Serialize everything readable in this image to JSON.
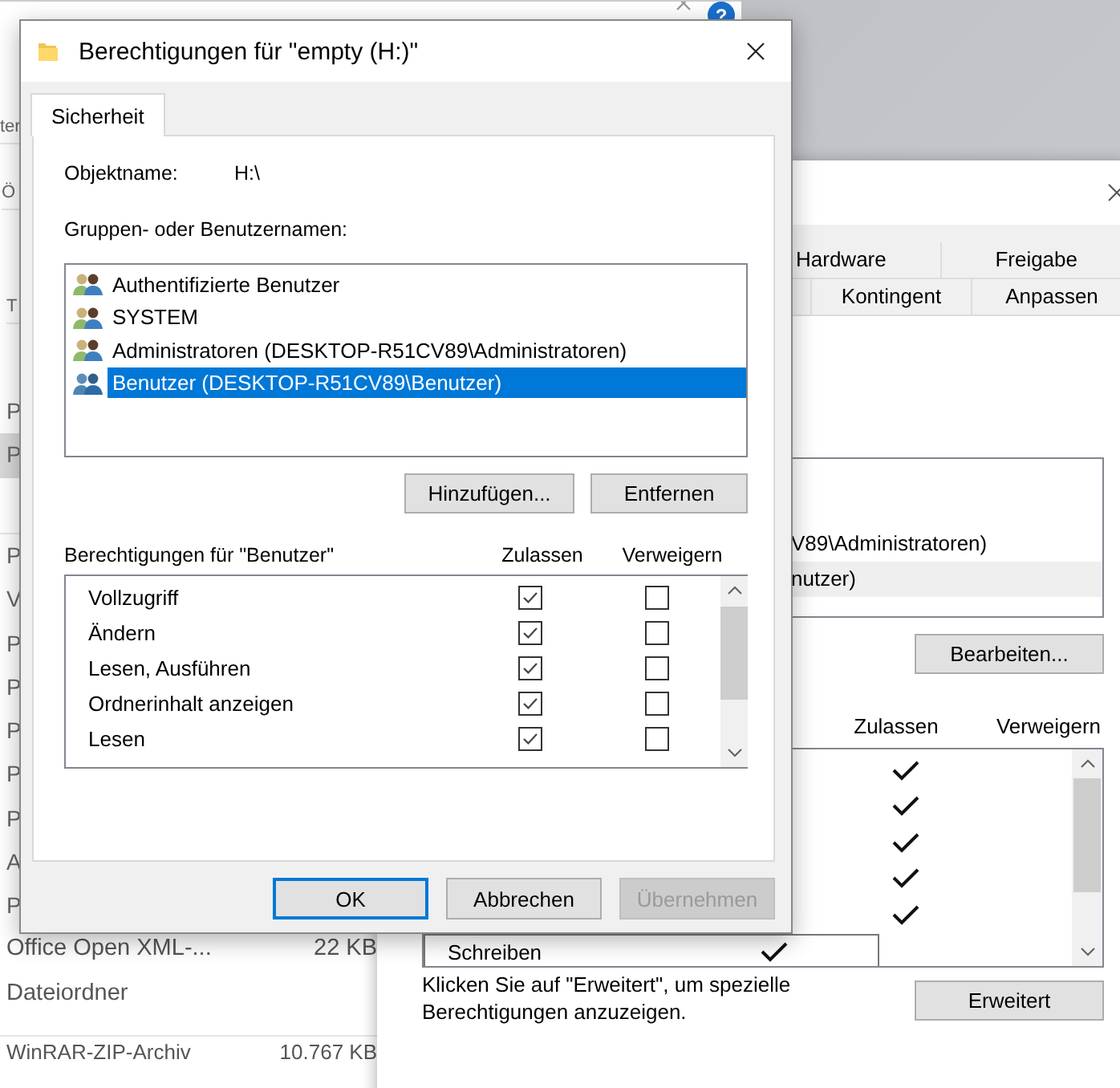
{
  "explorer": {
    "help_glyph": "?",
    "fragments": [
      "ter",
      "Ö",
      "T"
    ],
    "rows_a": [
      {
        "text": "P",
        "selected": false
      },
      {
        "text": "P",
        "selected": true
      }
    ],
    "rows_b": [
      "P",
      "V",
      "P",
      "P",
      "P",
      "P",
      "P",
      "A",
      "P"
    ],
    "files": [
      {
        "type": "Office Open XML-...",
        "size": "22 KB"
      },
      {
        "type": "Dateiordner"
      },
      {
        "type": "WinRAR-ZIP-Archiv",
        "size": "10.767 KB"
      }
    ]
  },
  "properties": {
    "tab_rows": [
      [
        {
          "label": "Hardware",
          "selected": false
        },
        {
          "label": "Freigabe",
          "selected": false
        }
      ],
      [
        {
          "label": "Kontingent",
          "selected": false
        },
        {
          "label": "Anpassen",
          "selected": false
        }
      ]
    ],
    "groups": [
      {
        "text": "V89\\Administratoren)",
        "selected": false
      },
      {
        "text": "nutzer)",
        "selected": true
      }
    ],
    "edit_button": "Bearbeiten...",
    "columns": [
      "Zulassen",
      "Verweigern"
    ],
    "permissions": [
      {
        "allow": true,
        "deny": false
      },
      {
        "allow": true,
        "deny": false
      },
      {
        "allow": true,
        "deny": false
      },
      {
        "allow": true,
        "deny": false
      },
      {
        "allow": true,
        "deny": false
      },
      {
        "label": "Schreiben",
        "allow": true,
        "deny": false
      }
    ],
    "note": "Klicken Sie auf \"Erweitert\", um spezielle Berechtigungen anzuzeigen.",
    "advanced_button": "Erweitert"
  },
  "dialog": {
    "title": "Berechtigungen für \"empty (H:)\"",
    "tab": {
      "label": "Sicherheit",
      "selected": true
    },
    "object_label": "Objektname:",
    "object_value": "H:\\",
    "groups_label": "Gruppen- oder Benutzernamen:",
    "groups": [
      {
        "name": "Authentifizierte Benutzer",
        "selected": false
      },
      {
        "name": "SYSTEM",
        "selected": false
      },
      {
        "name": "Administratoren (DESKTOP-R51CV89\\Administratoren)",
        "selected": false
      },
      {
        "name": "Benutzer (DESKTOP-R51CV89\\Benutzer)",
        "selected": true
      }
    ],
    "add_button": "Hinzufügen...",
    "remove_button": "Entfernen",
    "perms_label": "Berechtigungen für \"Benutzer\"",
    "columns": [
      "Zulassen",
      "Verweigern"
    ],
    "permissions": [
      {
        "label": "Vollzugriff",
        "allow": true,
        "deny": false
      },
      {
        "label": "Ändern",
        "allow": true,
        "deny": false
      },
      {
        "label": "Lesen, Ausführen",
        "allow": true,
        "deny": false
      },
      {
        "label": "Ordnerinhalt anzeigen",
        "allow": true,
        "deny": false
      },
      {
        "label": "Lesen",
        "allow": true,
        "deny": false
      }
    ],
    "buttons": [
      {
        "label": "OK",
        "focused": true,
        "disabled": false
      },
      {
        "label": "Abbrechen",
        "focused": false,
        "disabled": false
      },
      {
        "label": "Übernehmen",
        "focused": false,
        "disabled": true
      }
    ]
  }
}
